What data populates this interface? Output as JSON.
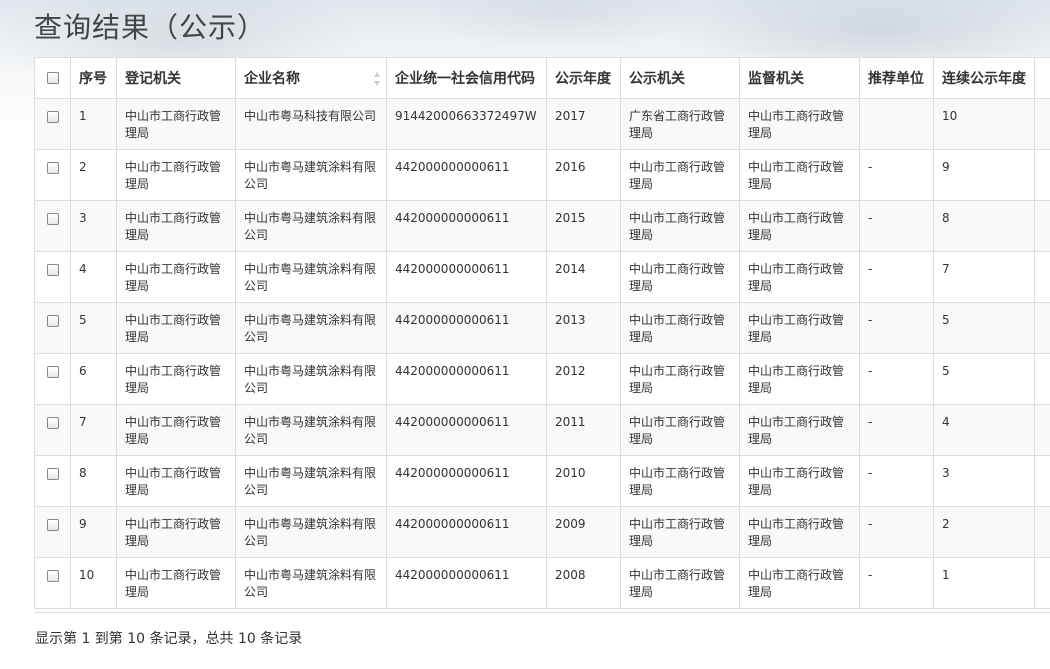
{
  "page": {
    "title": "查询结果（公示）"
  },
  "table": {
    "headers": [
      "序号",
      "登记机关",
      "企业名称",
      "企业统一社会信用代码",
      "公示年度",
      "公示机关",
      "监督机关",
      "推荐单位",
      "连续公示年度"
    ],
    "rows": [
      [
        "1",
        "中山市工商行政管理局",
        "中山市粤马科技有限公司",
        "91442000663372497W",
        "2017",
        "广东省工商行政管理局",
        "中山市工商行政管理局",
        "",
        "10"
      ],
      [
        "2",
        "中山市工商行政管理局",
        "中山市粤马建筑涂料有限公司",
        "442000000000611",
        "2016",
        "中山市工商行政管理局",
        "中山市工商行政管理局",
        "-",
        "9"
      ],
      [
        "3",
        "中山市工商行政管理局",
        "中山市粤马建筑涂料有限公司",
        "442000000000611",
        "2015",
        "中山市工商行政管理局",
        "中山市工商行政管理局",
        "-",
        "8"
      ],
      [
        "4",
        "中山市工商行政管理局",
        "中山市粤马建筑涂料有限公司",
        "442000000000611",
        "2014",
        "中山市工商行政管理局",
        "中山市工商行政管理局",
        "-",
        "7"
      ],
      [
        "5",
        "中山市工商行政管理局",
        "中山市粤马建筑涂料有限公司",
        "442000000000611",
        "2013",
        "中山市工商行政管理局",
        "中山市工商行政管理局",
        "-",
        "5"
      ],
      [
        "6",
        "中山市工商行政管理局",
        "中山市粤马建筑涂料有限公司",
        "442000000000611",
        "2012",
        "中山市工商行政管理局",
        "中山市工商行政管理局",
        "-",
        "5"
      ],
      [
        "7",
        "中山市工商行政管理局",
        "中山市粤马建筑涂料有限公司",
        "442000000000611",
        "2011",
        "中山市工商行政管理局",
        "中山市工商行政管理局",
        "-",
        "4"
      ],
      [
        "8",
        "中山市工商行政管理局",
        "中山市粤马建筑涂料有限公司",
        "442000000000611",
        "2010",
        "中山市工商行政管理局",
        "中山市工商行政管理局",
        "-",
        "3"
      ],
      [
        "9",
        "中山市工商行政管理局",
        "中山市粤马建筑涂料有限公司",
        "442000000000611",
        "2009",
        "中山市工商行政管理局",
        "中山市工商行政管理局",
        "-",
        "2"
      ],
      [
        "10",
        "中山市工商行政管理局",
        "中山市粤马建筑涂料有限公司",
        "442000000000611",
        "2008",
        "中山市工商行政管理局",
        "中山市工商行政管理局",
        "-",
        "1"
      ]
    ]
  },
  "pagination": {
    "summary": "显示第 1 到第 10 条记录，总共 10 条记录"
  },
  "icons": {
    "sort": "sort-both-icon",
    "checkbox": "checkbox-unchecked"
  }
}
